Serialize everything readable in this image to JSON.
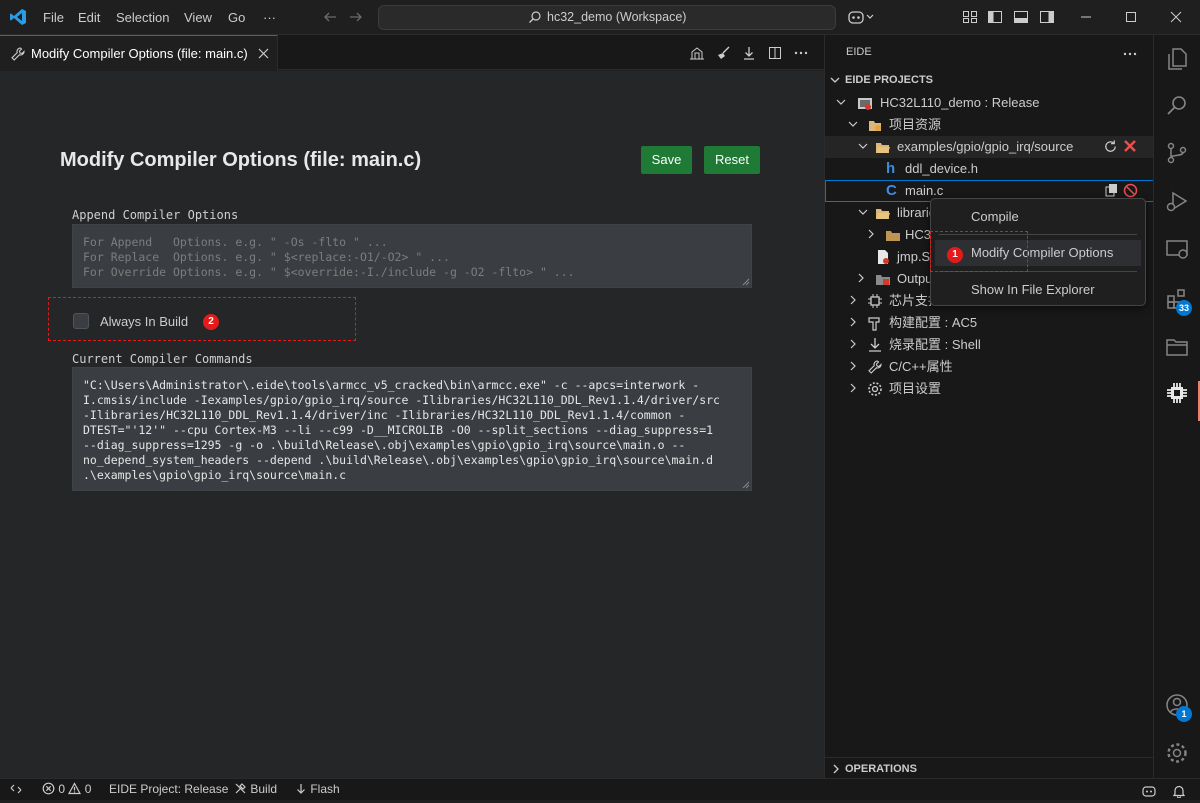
{
  "titlebar": {
    "menus": [
      "File",
      "Edit",
      "Selection",
      "View",
      "Go",
      "···"
    ],
    "command_center": "hc32_demo (Workspace)"
  },
  "editor": {
    "tab_title": "Modify Compiler Options (file: main.c)",
    "page_title": "Modify Compiler Options (file: main.c)",
    "save_label": "Save",
    "reset_label": "Reset",
    "append_label": "Append Compiler Options",
    "append_placeholder": [
      "For Append   Options. e.g. \" -Os -flto \" ...",
      "For Replace  Options. e.g. \" $<replace:-O1/-O2> \" ...",
      "For Override Options. e.g. \" $<override:-I./include -g -O2 -flto> \" ..."
    ],
    "always_build_label": "Always In Build",
    "always_build_checked": false,
    "badge_2": "2",
    "current_label": "Current Compiler Commands",
    "command_lines": [
      "\"C:\\Users\\Administrator\\.eide\\tools\\armcc_v5_cracked\\bin\\armcc.exe\" -c --apcs=interwork -",
      "I.cmsis/include -Iexamples/gpio/gpio_irq/source -Ilibraries/HC32L110_DDL_Rev1.1.4/driver/src",
      "-Ilibraries/HC32L110_DDL_Rev1.1.4/driver/inc -Ilibraries/HC32L110_DDL_Rev1.1.4/common -",
      "DTEST=\"'12'\" --cpu Cortex-M3 --li --c99 -D__MICROLIB -O0 --split_sections --diag_suppress=1",
      "--diag_suppress=1295 -g -o .\\build\\Release\\.obj\\examples\\gpio\\gpio_irq\\source\\main.o --",
      "no_depend_system_headers --depend .\\build\\Release\\.obj\\examples\\gpio\\gpio_irq\\source\\main.d",
      ".\\examples\\gpio\\gpio_irq\\source\\main.c"
    ]
  },
  "sidebar": {
    "title": "EIDE",
    "section_projects": "EIDE PROJECTS",
    "section_operations": "OPERATIONS",
    "tree": {
      "project": "HC32L110_demo : Release",
      "resources": "项目资源",
      "folder_source": "examples/gpio/gpio_irq/source",
      "file_h": "ddl_device.h",
      "file_c": "main.c",
      "libraries": "libraries",
      "hc32": "HC32L",
      "jmp": "jmp.S",
      "output": "Output",
      "chip": "芯片支持",
      "build_config": "构建配置 : AC5",
      "flash_config": "烧录配置 : Shell",
      "cpp_props": "C/C++属性",
      "project_settings": "项目设置"
    }
  },
  "context_menu": {
    "items": [
      "Compile",
      "Modify Compiler Options",
      "Show In File Explorer"
    ],
    "badge_1": "1"
  },
  "activity": {
    "extensions_badge": "33",
    "accounts_badge": "1"
  },
  "statusbar": {
    "errors": "0",
    "warnings": "0",
    "project": "EIDE Project: Release",
    "build": "Build",
    "flash": "Flash"
  },
  "colors": {
    "accent": "#0078d4",
    "button_green": "#1e7a34",
    "badge_red": "#e51b1b"
  }
}
